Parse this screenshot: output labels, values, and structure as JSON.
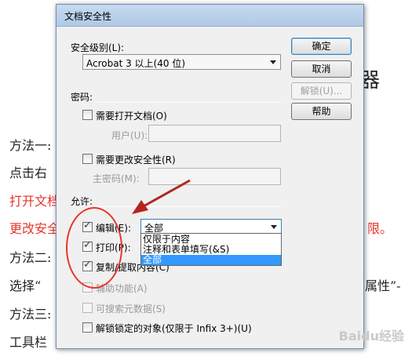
{
  "background": {
    "heading": "器",
    "lines": [
      "方法一:",
      "点击右",
      "打开文档",
      "更改安全",
      "方法二:",
      "选择“",
      "方法三:",
      "工具栏"
    ],
    "right_fragments": [
      "限。",
      "属性”-"
    ]
  },
  "dialog": {
    "title": "文档安全性",
    "security_level_label": "安全级别(L):",
    "security_level_value": "Acrobat 3 以上(40 位)",
    "password_section": "密码:",
    "require_open_password": "需要打开文档(O)",
    "user_label": "用户(U):",
    "require_change_security": "需要更改安全性(R)",
    "master_password_label": "主密码(M):",
    "permissions_section": "允许:",
    "permissions": {
      "edit": {
        "label": "编辑(E):",
        "checked": true
      },
      "print": {
        "label": "打印(P):",
        "checked": true
      },
      "copy": {
        "label": "复制/提取内容(C)",
        "checked": true
      },
      "accessibility": {
        "label": "辅助功能(A)",
        "checked": false
      },
      "searchable_metadata": {
        "label": "可搜索元数据(S)",
        "checked": false
      },
      "unlock_locked_objects": {
        "label": "解锁锁定的对象(仅限于 Infix 3+)(U)",
        "checked": false
      }
    },
    "edit_combo_value": "全部",
    "edit_dropdown_options": [
      "仅限于内容",
      "注释和表单填写(&S)",
      "全部"
    ],
    "edit_dropdown_selected": "全部",
    "buttons": {
      "ok": "确定",
      "cancel": "取消",
      "unlock": "解锁(U)...",
      "help": "帮助"
    }
  },
  "annotation_color": "#e8352a",
  "watermark": "Baidu经验"
}
